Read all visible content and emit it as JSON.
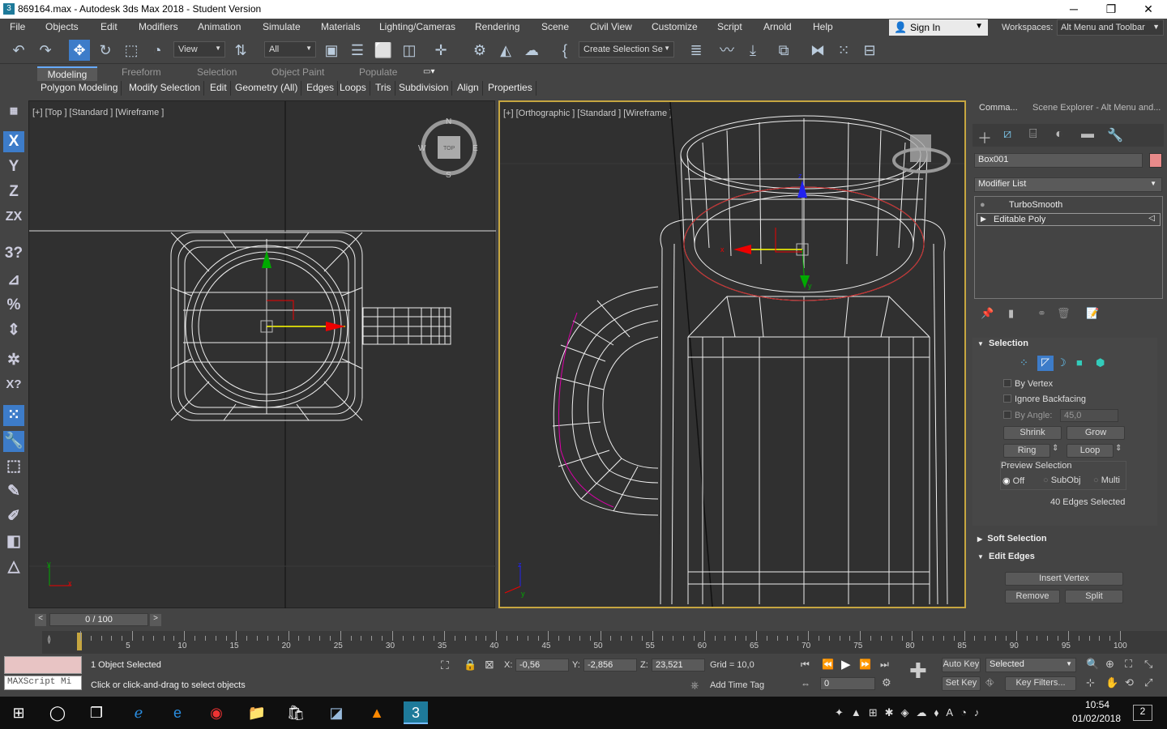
{
  "window": {
    "title": "869164.max - Autodesk 3ds Max 2018 - Student Version",
    "app_icon": "3ds-max-icon",
    "minimize": "─",
    "maximize": "❐",
    "close": "✕"
  },
  "menu": {
    "items": [
      "File",
      "Objects",
      "Edit",
      "Modifiers",
      "Animation",
      "Simulate",
      "Materials",
      "Lighting/Cameras",
      "Rendering",
      "Scene",
      "Civil View",
      "Customize",
      "Script",
      "Arnold",
      "Help"
    ],
    "sign_in": "Sign In",
    "workspaces_label": "Workspaces:",
    "workspace_value": "Alt Menu and Toolbar"
  },
  "toolbar": {
    "ref_coord": "View",
    "selection_filter": "All",
    "named_selection": "Create Selection Se"
  },
  "ribbon": {
    "tabs": [
      "Modeling",
      "Freeform",
      "Selection",
      "Object Paint",
      "Populate"
    ],
    "active_tab": "Modeling",
    "subtabs": [
      "Polygon Modeling",
      "Modify Selection",
      "Edit",
      "Geometry (All)",
      "Edges",
      "Loops",
      "Tris",
      "Subdivision",
      "Align",
      "Properties"
    ]
  },
  "left_tools": [
    "X",
    "Y",
    "Z",
    "ZX",
    "3",
    "?",
    "%",
    "?",
    "?",
    "X?",
    "?",
    "?",
    "?",
    "?",
    "?",
    "?",
    "?"
  ],
  "viewports": {
    "left_label": "[+] [Top ] [Standard ] [Wireframe ]",
    "right_label": "[+] [Orthographic ] [Standard ] [Wireframe ]",
    "viewcube_top": "TOP",
    "compass": {
      "n": "N",
      "s": "S",
      "e": "E",
      "w": "W"
    },
    "axis_x": "x",
    "axis_y": "y",
    "axis_z": "z"
  },
  "command_panel": {
    "tabs": [
      "Comma...",
      "Scene Explorer - Alt Menu and..."
    ],
    "object_name": "Box001",
    "object_color": "#e88a8a",
    "modifier_list": "Modifier List",
    "stack": [
      "TurboSmooth",
      "Editable Poly"
    ],
    "selection_rollout": {
      "title": "Selection",
      "by_vertex": "By Vertex",
      "ignore_backfacing": "Ignore Backfacing",
      "by_angle": "By Angle:",
      "angle_value": "45,0",
      "shrink": "Shrink",
      "grow": "Grow",
      "ring": "Ring",
      "loop": "Loop",
      "preview_selection": "Preview Selection",
      "preview_options": [
        "Off",
        "SubObj",
        "Multi"
      ],
      "selected_info": "40 Edges Selected"
    },
    "soft_selection": "Soft Selection",
    "edit_edges": {
      "title": "Edit Edges",
      "insert_vertex": "Insert Vertex",
      "remove": "Remove",
      "split": "Split"
    }
  },
  "timeline": {
    "frame_display": "0 / 100",
    "ticks": [
      "5",
      "10",
      "15",
      "20",
      "25",
      "30",
      "35",
      "40",
      "45",
      "50",
      "55",
      "60",
      "65",
      "70",
      "75",
      "80",
      "85",
      "90",
      "95",
      "100"
    ]
  },
  "status": {
    "maxscript": "MAXScript Mi",
    "objects_selected": "1 Object Selected",
    "prompt": "Click or click-and-drag to select objects",
    "x_label": "X:",
    "x_value": "-0,56",
    "y_label": "Y:",
    "y_value": "-2,856",
    "z_label": "Z:",
    "z_value": "23,521",
    "grid": "Grid = 10,0",
    "add_time_tag": "Add Time Tag",
    "auto_key": "Auto Key",
    "set_key": "Set Key",
    "selected": "Selected",
    "key_filters": "Key Filters...",
    "frame_value": "0"
  },
  "taskbar": {
    "time": "10:54",
    "date": "01/02/2018",
    "notifications": "2"
  }
}
